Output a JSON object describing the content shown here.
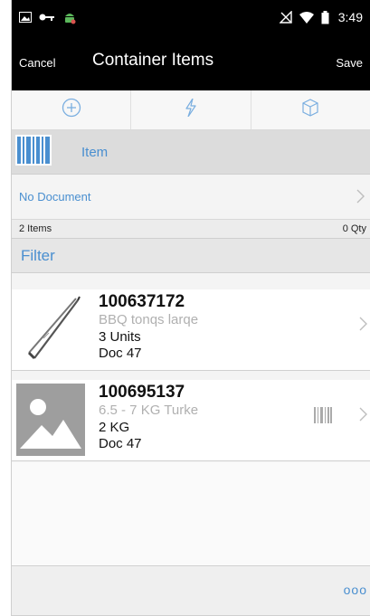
{
  "status_bar": {
    "time": "3:49",
    "left_icons": [
      "gallery-icon",
      "key-icon",
      "android-notify-icon"
    ],
    "right_icons": [
      "no-signal-icon",
      "wifi-icon",
      "battery-icon"
    ]
  },
  "app_bar": {
    "cancel_label": "Cancel",
    "title": "Container Items",
    "save_label": "Save"
  },
  "toolbar": {
    "icons": [
      "add-circle-icon",
      "lightning-icon",
      "cube-icon"
    ]
  },
  "scan": {
    "label": "Item",
    "icon": "barcode-icon"
  },
  "document": {
    "label": "No Document"
  },
  "summary": {
    "items": "2 Items",
    "qty": "0 Qty"
  },
  "filter": {
    "label": "Filter"
  },
  "items": [
    {
      "number": "100637172",
      "description": "BBQ tonqs larqe",
      "quantity": "3  Units",
      "doc": "Doc 47",
      "image": "tongs-image"
    },
    {
      "number": "100695137",
      "description": "6.5 - 7 KG Turke",
      "quantity": "2  KG",
      "doc": "Doc 47",
      "image": "placeholder-image"
    }
  ],
  "footer": {
    "more_label": "ooo"
  },
  "colors": {
    "accent": "#4a8fd0",
    "bar": "#000000",
    "muted": "#b0b0b0"
  }
}
